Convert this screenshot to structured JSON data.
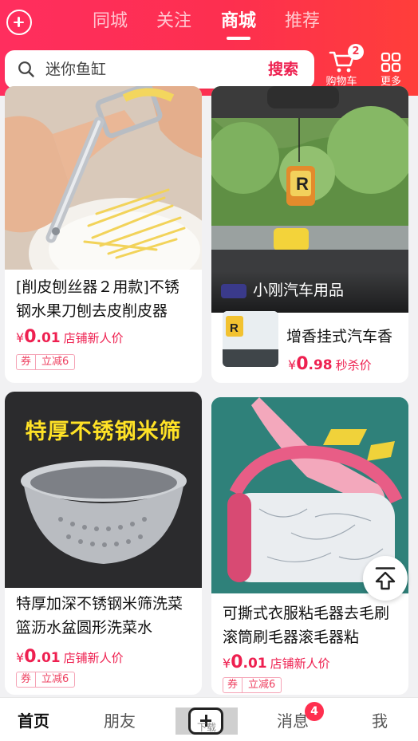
{
  "header": {
    "tabs": [
      {
        "label": "同城",
        "active": false
      },
      {
        "label": "关注",
        "active": false
      },
      {
        "label": "商城",
        "active": true
      },
      {
        "label": "推荐",
        "active": false
      }
    ],
    "search": {
      "query": "迷你鱼缸",
      "button_label": "搜索"
    },
    "cart": {
      "label": "购物车",
      "badge": "2"
    },
    "more": {
      "label": "更多"
    },
    "accent_color": "#ff2e5e"
  },
  "products": [
    {
      "title": "[削皮刨丝器２用款]不锈钢水果刀刨去皮削皮器",
      "price_yen": "¥",
      "price_int": "0",
      "price_dec": ".01",
      "price_tag": "店铺新人价",
      "coupon_label": "券",
      "coupon_value": "立减6"
    },
    {
      "shop_name": "小刚汽车用品",
      "title": "增香挂式汽车香",
      "price_yen": "¥",
      "price_int": "0",
      "price_dec": ".98",
      "price_tag": "秒杀价"
    },
    {
      "image_headline": "特厚不锈钢米筛",
      "title": "特厚加深不锈钢米筛洗菜篮沥水盆圆形洗菜水",
      "price_yen": "¥",
      "price_int": "0",
      "price_dec": ".01",
      "price_tag": "店铺新人价",
      "coupon_label": "券",
      "coupon_value": "立减6"
    },
    {
      "title": "可撕式衣服粘毛器去毛刷滚筒刷毛器滚毛器粘",
      "price_yen": "¥",
      "price_int": "0",
      "price_dec": ".01",
      "price_tag": "店铺新人价",
      "coupon_label": "券",
      "coupon_value": "立减6"
    }
  ],
  "bottom_nav": {
    "items": [
      {
        "label": "首页",
        "active": true
      },
      {
        "label": "朋友",
        "active": false
      },
      {
        "label": "消息",
        "active": false
      },
      {
        "label": "我",
        "active": false
      }
    ],
    "center_label": "下载",
    "message_badge": "4"
  }
}
